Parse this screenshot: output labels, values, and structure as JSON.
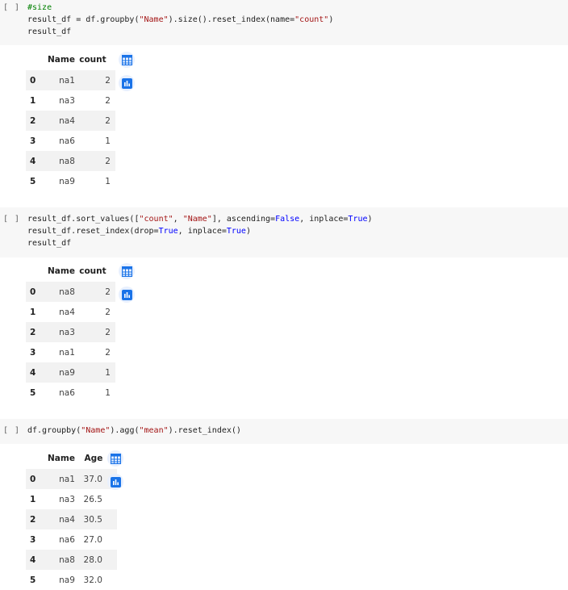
{
  "cells": [
    {
      "run_bracket": "[ ]",
      "code_lines": [
        [
          {
            "t": "#size",
            "c": "comment"
          }
        ],
        [
          {
            "t": "result_df = df.groupby(",
            "c": ""
          },
          {
            "t": "\"Name\"",
            "c": "str"
          },
          {
            "t": ").size().reset_index(name=",
            "c": ""
          },
          {
            "t": "\"count\"",
            "c": "str"
          },
          {
            "t": ")",
            "c": ""
          }
        ],
        [
          {
            "t": "result_df",
            "c": ""
          }
        ]
      ],
      "table": {
        "columns": [
          "Name",
          "count"
        ],
        "rows": [
          [
            "0",
            "na1",
            "2"
          ],
          [
            "1",
            "na3",
            "2"
          ],
          [
            "2",
            "na4",
            "2"
          ],
          [
            "3",
            "na6",
            "1"
          ],
          [
            "4",
            "na8",
            "2"
          ],
          [
            "5",
            "na9",
            "1"
          ]
        ]
      }
    },
    {
      "run_bracket": "[ ]",
      "code_lines": [
        [
          {
            "t": "result_df.sort_values([",
            "c": ""
          },
          {
            "t": "\"count\"",
            "c": "str"
          },
          {
            "t": ", ",
            "c": ""
          },
          {
            "t": "\"Name\"",
            "c": "str"
          },
          {
            "t": "], ascending=",
            "c": ""
          },
          {
            "t": "False",
            "c": "kw"
          },
          {
            "t": ", inplace=",
            "c": ""
          },
          {
            "t": "True",
            "c": "kw"
          },
          {
            "t": ")",
            "c": ""
          }
        ],
        [
          {
            "t": "result_df.reset_index(drop=",
            "c": ""
          },
          {
            "t": "True",
            "c": "kw"
          },
          {
            "t": ", inplace=",
            "c": ""
          },
          {
            "t": "True",
            "c": "kw"
          },
          {
            "t": ")",
            "c": ""
          }
        ],
        [
          {
            "t": "result_df",
            "c": ""
          }
        ]
      ],
      "table": {
        "columns": [
          "Name",
          "count"
        ],
        "rows": [
          [
            "0",
            "na8",
            "2"
          ],
          [
            "1",
            "na4",
            "2"
          ],
          [
            "2",
            "na3",
            "2"
          ],
          [
            "3",
            "na1",
            "2"
          ],
          [
            "4",
            "na9",
            "1"
          ],
          [
            "5",
            "na6",
            "1"
          ]
        ]
      }
    },
    {
      "run_bracket": "[ ]",
      "code_lines": [
        [
          {
            "t": "df.groupby(",
            "c": ""
          },
          {
            "t": "\"Name\"",
            "c": "str"
          },
          {
            "t": ").agg(",
            "c": ""
          },
          {
            "t": "\"mean\"",
            "c": "str"
          },
          {
            "t": ").reset_index()",
            "c": ""
          }
        ]
      ],
      "table": {
        "columns": [
          "Name",
          "Age"
        ],
        "rows": [
          [
            "0",
            "na1",
            "37.0"
          ],
          [
            "1",
            "na3",
            "26.5"
          ],
          [
            "2",
            "na4",
            "30.5"
          ],
          [
            "3",
            "na6",
            "27.0"
          ],
          [
            "4",
            "na8",
            "28.0"
          ],
          [
            "5",
            "na9",
            "32.0"
          ]
        ]
      }
    }
  ],
  "icons": {
    "table_icon": "table-icon",
    "chart_icon": "bar-chart-icon"
  },
  "colors": {
    "icon_bg": "#e8f0fe",
    "icon_blue": "#1a73e8",
    "code_bg": "#f7f7f7"
  }
}
